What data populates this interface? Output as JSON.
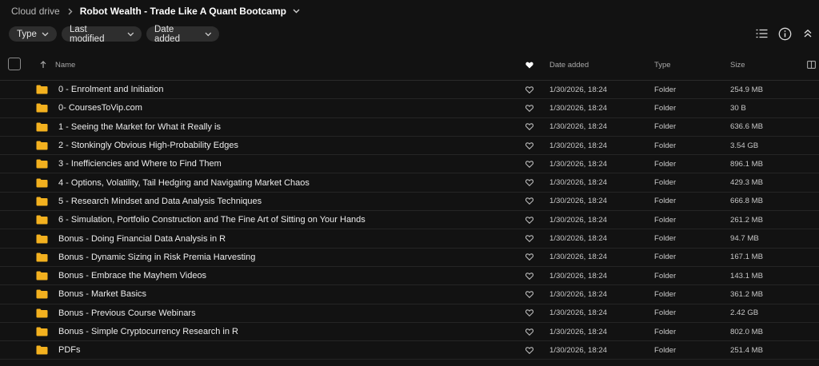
{
  "breadcrumb": {
    "root": "Cloud drive",
    "current": "Robot Wealth - Trade Like A Quant Bootcamp"
  },
  "filters": {
    "type": "Type",
    "last_modified": "Last modified",
    "date_added": "Date added"
  },
  "toolbar": {
    "list_icon": "list-view-icon",
    "info_icon": "info-icon",
    "collapse_icon": "collapse-icon"
  },
  "table": {
    "columns": {
      "name": "Name",
      "date_added": "Date added",
      "type": "Type",
      "size": "Size"
    },
    "rows": [
      {
        "name": "0 - Enrolment and Initiation",
        "date": "1/30/2026, 18:24",
        "type": "Folder",
        "size": "254.9 MB"
      },
      {
        "name": "0- CoursesToVip.com",
        "date": "1/30/2026, 18:24",
        "type": "Folder",
        "size": "30 B"
      },
      {
        "name": "1 - Seeing the Market for What it Really is",
        "date": "1/30/2026, 18:24",
        "type": "Folder",
        "size": "636.6 MB"
      },
      {
        "name": "2 - Stonkingly Obvious High-Probability Edges",
        "date": "1/30/2026, 18:24",
        "type": "Folder",
        "size": "3.54 GB"
      },
      {
        "name": "3 - Inefficiencies and Where to Find Them",
        "date": "1/30/2026, 18:24",
        "type": "Folder",
        "size": "896.1 MB"
      },
      {
        "name": "4 - Options, Volatility, Tail Hedging and Navigating Market Chaos",
        "date": "1/30/2026, 18:24",
        "type": "Folder",
        "size": "429.3 MB"
      },
      {
        "name": "5 - Research Mindset and Data Analysis Techniques",
        "date": "1/30/2026, 18:24",
        "type": "Folder",
        "size": "666.8 MB"
      },
      {
        "name": "6 - Simulation, Portfolio Construction and The Fine Art of Sitting on Your Hands",
        "date": "1/30/2026, 18:24",
        "type": "Folder",
        "size": "261.2 MB"
      },
      {
        "name": "Bonus - Doing Financial Data Analysis in R",
        "date": "1/30/2026, 18:24",
        "type": "Folder",
        "size": "94.7 MB"
      },
      {
        "name": "Bonus - Dynamic Sizing in Risk Premia Harvesting",
        "date": "1/30/2026, 18:24",
        "type": "Folder",
        "size": "167.1 MB"
      },
      {
        "name": "Bonus - Embrace the Mayhem Videos",
        "date": "1/30/2026, 18:24",
        "type": "Folder",
        "size": "143.1 MB"
      },
      {
        "name": "Bonus - Market Basics",
        "date": "1/30/2026, 18:24",
        "type": "Folder",
        "size": "361.2 MB"
      },
      {
        "name": "Bonus - Previous Course Webinars",
        "date": "1/30/2026, 18:24",
        "type": "Folder",
        "size": "2.42 GB"
      },
      {
        "name": "Bonus - Simple Cryptocurrency Research in R",
        "date": "1/30/2026, 18:24",
        "type": "Folder",
        "size": "802.0 MB"
      },
      {
        "name": "PDFs",
        "date": "1/30/2026, 18:24",
        "type": "Folder",
        "size": "251.4 MB"
      }
    ]
  },
  "colors": {
    "background": "#121212",
    "folder": "#f3b11f",
    "chip": "#2e2e2e"
  }
}
